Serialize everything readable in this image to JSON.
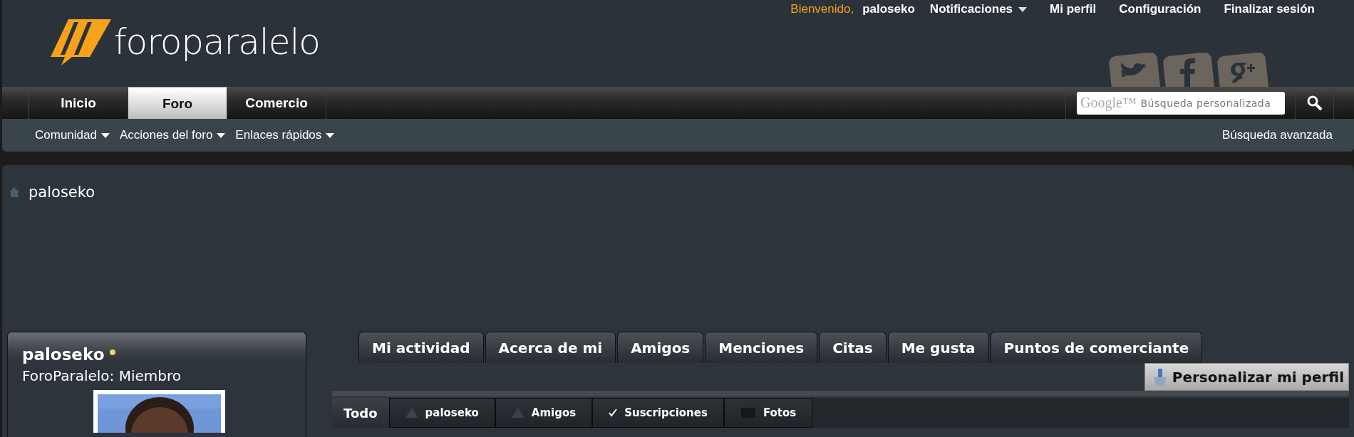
{
  "logo": {
    "text": "foroparalelo"
  },
  "user_bar": {
    "greeting": "Bienvenido,",
    "username": "paloseko",
    "links": [
      {
        "label": "Notificaciones",
        "dropdown": true
      },
      {
        "label": "Mi perfil",
        "dropdown": false
      },
      {
        "label": "Configuración",
        "dropdown": false
      },
      {
        "label": "Finalizar sesión",
        "dropdown": false
      }
    ]
  },
  "nav_tabs": [
    {
      "label": "Inicio",
      "selected": false
    },
    {
      "label": "Foro",
      "selected": true
    },
    {
      "label": "Comercio",
      "selected": false
    }
  ],
  "search": {
    "brand": "Google™",
    "placeholder": "Búsqueda personalizada"
  },
  "sub_nav": {
    "menus": [
      "Comunidad",
      "Acciones del foro",
      "Enlaces rápidos"
    ],
    "advanced_search": "Búsqueda avanzada"
  },
  "breadcrumb": "paloseko",
  "profile": {
    "name": "paloseko",
    "online": true,
    "rank": "ForoParalelo: Miembro"
  },
  "profile_tabs": [
    "Mi actividad",
    "Acerca de mi",
    "Amigos",
    "Menciones",
    "Citas",
    "Me gusta",
    "Puntos de comerciante"
  ],
  "customize_button": "Personalizar mi perfil",
  "activity_filters": [
    {
      "label": "Todo",
      "selected": true
    },
    {
      "label": "paloseko",
      "selected": false
    },
    {
      "label": "Amigos",
      "selected": false
    },
    {
      "label": "Suscripciones",
      "selected": false
    },
    {
      "label": "Fotos",
      "selected": false
    }
  ]
}
